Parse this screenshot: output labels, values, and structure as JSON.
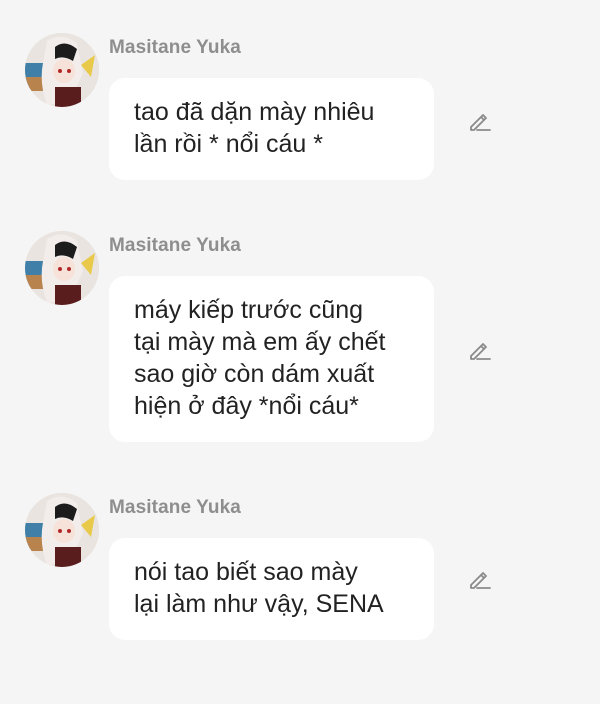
{
  "messages": [
    {
      "sender": "Masitane Yuka",
      "text": "tao đã dặn mày nhiêu\nlần rồi * nổi cáu *",
      "edit_icon": "pencil-icon"
    },
    {
      "sender": "Masitane Yuka",
      "text": "máy kiếp trước cũng\ntại mày mà em ấy chết\nsao giờ còn dám xuất\nhiện ở đây *nổi cáu*",
      "edit_icon": "pencil-icon"
    },
    {
      "sender": "Masitane Yuka",
      "text": "nói tao biết sao mày\nlại làm như vậy, SENA",
      "edit_icon": "pencil-icon"
    }
  ],
  "colors": {
    "background": "#f5f5f5",
    "bubble": "#ffffff",
    "sender": "#8e8e8e",
    "text": "#222222",
    "icon": "#8a8a8a"
  }
}
